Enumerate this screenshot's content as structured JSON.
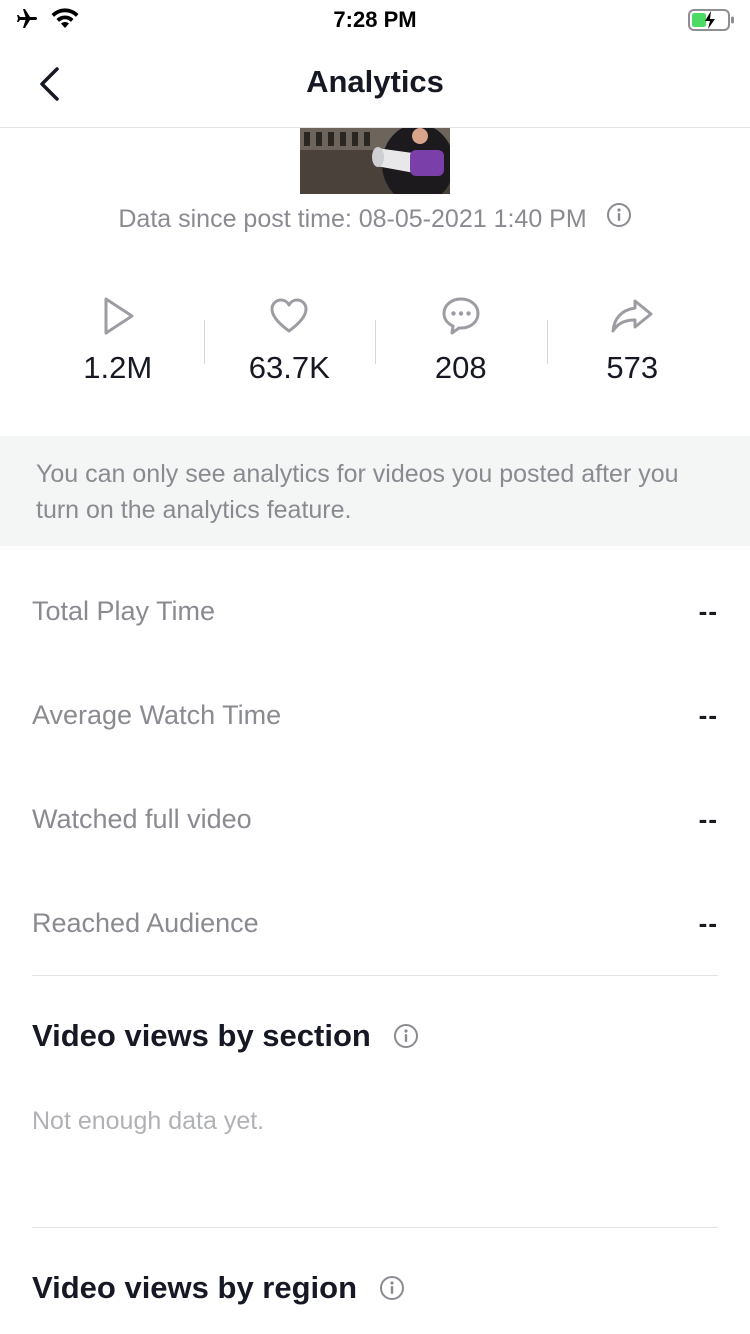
{
  "status_bar": {
    "time": "7:28 PM"
  },
  "nav": {
    "title": "Analytics",
    "back_icon": "chevron-left-icon"
  },
  "post": {
    "data_since": "Data since post time: 08-05-2021 1:40 PM"
  },
  "stats": [
    {
      "icon": "play-icon",
      "value": "1.2M"
    },
    {
      "icon": "heart-icon",
      "value": "63.7K"
    },
    {
      "icon": "comment-icon",
      "value": "208"
    },
    {
      "icon": "share-icon",
      "value": "573"
    }
  ],
  "banner": {
    "text": "You can only see analytics for videos you posted after you turn on the analytics feature."
  },
  "metrics": [
    {
      "label": "Total Play Time",
      "value": "--"
    },
    {
      "label": "Average Watch Time",
      "value": "--"
    },
    {
      "label": "Watched full video",
      "value": "--"
    },
    {
      "label": "Reached Audience",
      "value": "--"
    }
  ],
  "sections": {
    "by_section": {
      "title": "Video views by section",
      "empty": "Not enough data yet."
    },
    "by_region": {
      "title": "Video views by region"
    }
  },
  "colors": {
    "text_primary": "#161823",
    "text_secondary": "#8a8b91",
    "banner_bg": "#f4f5f5",
    "battery_green": "#4cd964"
  }
}
